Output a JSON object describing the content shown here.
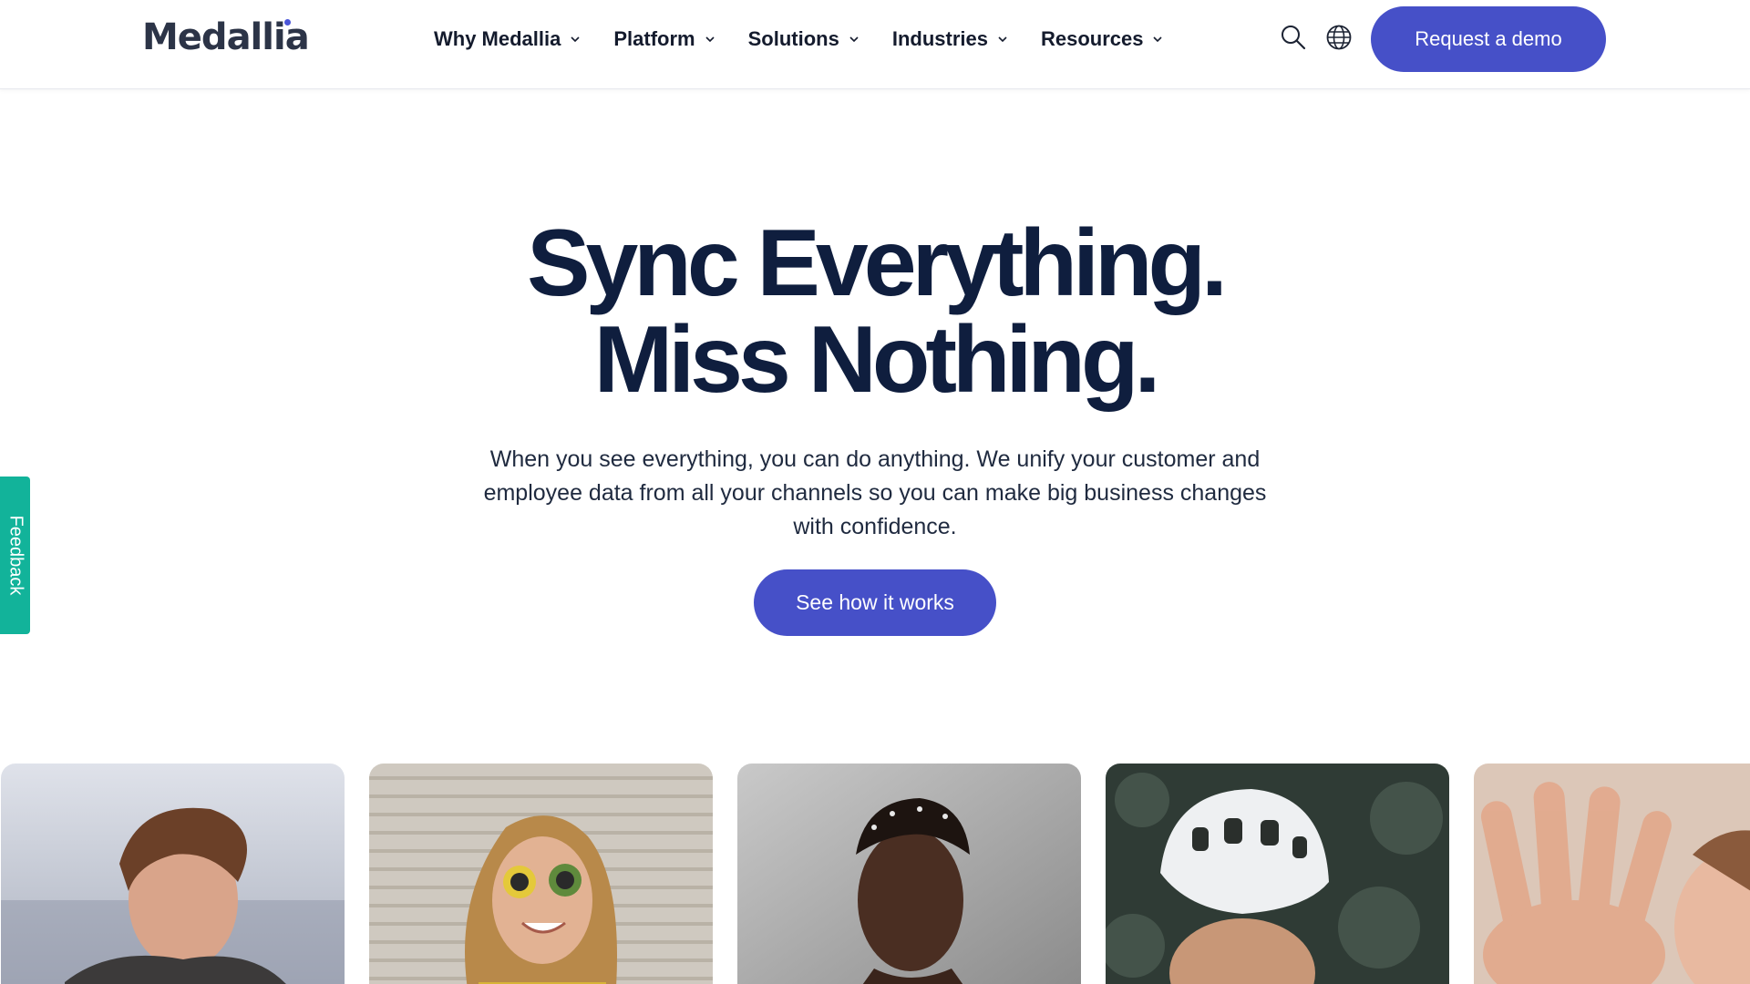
{
  "brand": {
    "logo_text": "Medallia",
    "accent": "#4650c8",
    "title_color": "#0f1e3e"
  },
  "nav": {
    "items": [
      {
        "label": "Why Medallia",
        "icon": "chevron-down-icon"
      },
      {
        "label": "Platform",
        "icon": "chevron-down-icon"
      },
      {
        "label": "Solutions",
        "icon": "chevron-down-icon"
      },
      {
        "label": "Industries",
        "icon": "chevron-down-icon"
      },
      {
        "label": "Resources",
        "icon": "chevron-down-icon"
      }
    ],
    "search_icon": "search-icon",
    "globe_icon": "globe-icon",
    "demo_label": "Request a demo"
  },
  "hero": {
    "title_line1": "Sync Everything.",
    "title_line2": "Miss Nothing.",
    "subtitle": "When you see everything, you can do anything. We unify your customer and employee data from all your channels so you can make big business changes with confidence.",
    "cta_label": "See how it works"
  },
  "feedback": {
    "label": "Feedback",
    "color": "#12b39a"
  },
  "cards": [
    {
      "name": "photo-man-laughing"
    },
    {
      "name": "photo-woman-sunglasses"
    },
    {
      "name": "photo-man-portrait"
    },
    {
      "name": "photo-cyclist-helmet"
    },
    {
      "name": "photo-hand-waving"
    }
  ]
}
